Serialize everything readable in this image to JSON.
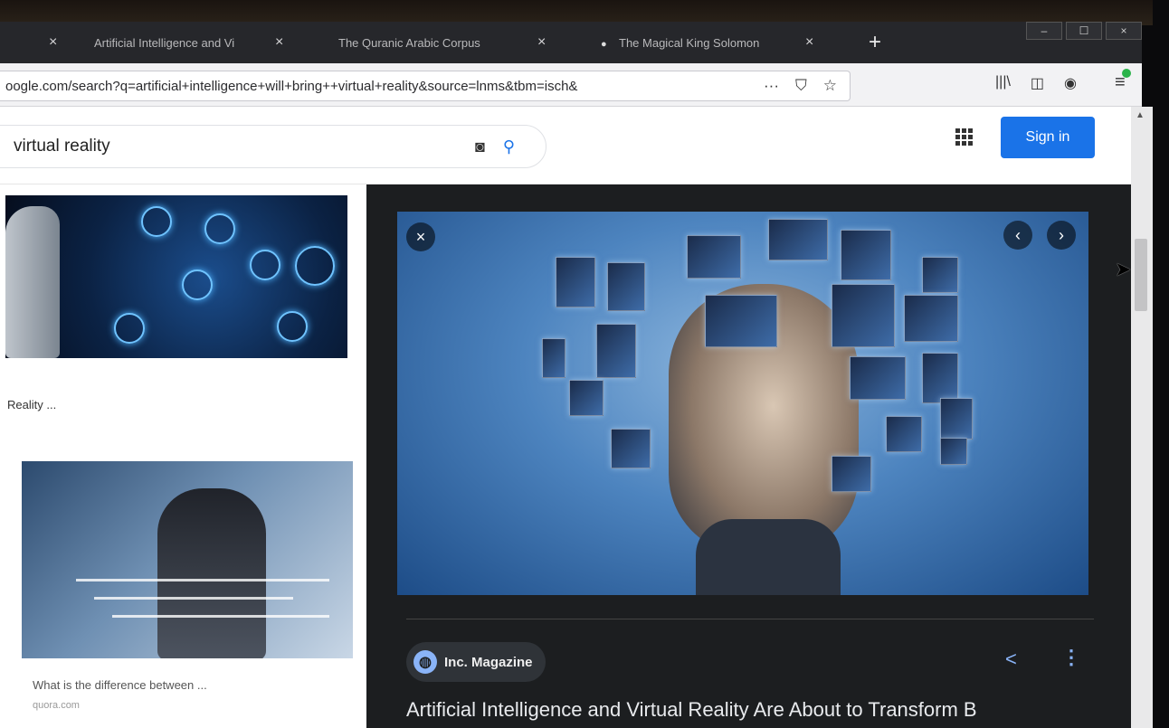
{
  "browser": {
    "tabs": [
      {
        "label": "",
        "close": "×"
      },
      {
        "label": "Artificial Intelligence and Vi",
        "close": "×"
      },
      {
        "label": "The Quranic Arabic Corpus",
        "close": "×"
      },
      {
        "label": "The Magical King Solomon",
        "close": "×"
      }
    ],
    "new_tab": "+",
    "window_controls": {
      "minimize": "–",
      "maximize": "☐",
      "close": "×"
    },
    "url": "oogle.com/search?q=artificial+intelligence+will+bring++virtual+reality&source=lnms&tbm=isch&",
    "url_icons": {
      "more": "···",
      "pocket": "⛉",
      "bookmark": "☆"
    },
    "toolbar_icons": {
      "library": "|||\\",
      "sidebar": "◫",
      "account": "◉",
      "menu": "≡"
    }
  },
  "google": {
    "search_query": "virtual reality",
    "sign_in": "Sign in"
  },
  "results": {
    "caption_1": "Reality ...",
    "caption_2": "What is the difference between ...",
    "source_2": "quora.com"
  },
  "viewer": {
    "close": "×",
    "prev": "‹",
    "next": "›",
    "source": "Inc. Magazine",
    "share": "<",
    "more": "⋮",
    "title": "Artificial Intelligence and Virtual Reality Are About to Transform B"
  },
  "colors": {
    "accent": "#1a73e8",
    "viewer_bg": "#1c1e20",
    "link_blue": "#8ab4f8"
  }
}
